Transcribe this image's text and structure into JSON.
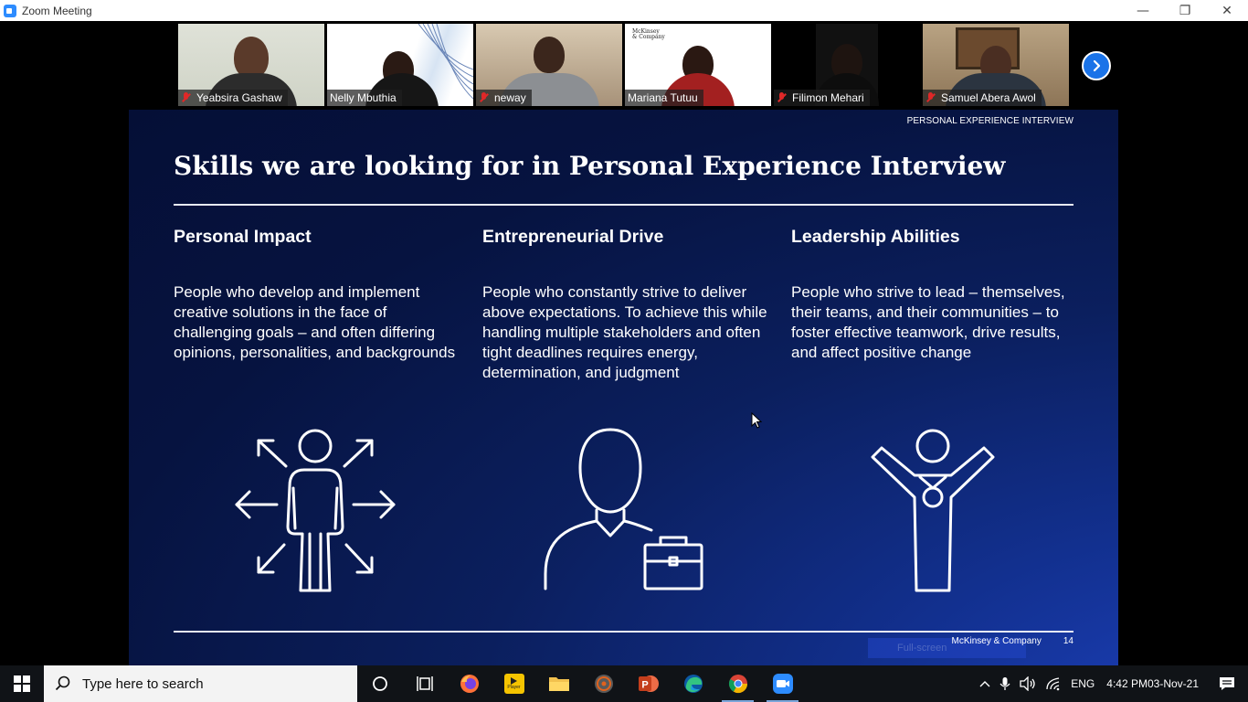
{
  "window": {
    "title": "Zoom Meeting",
    "minimize": "—",
    "restore": "❐",
    "close": "✕"
  },
  "gallery": {
    "participants": [
      {
        "name": "Yeabsira Gashaw",
        "muted": true
      },
      {
        "name": "Nelly Mbuthia",
        "muted": false
      },
      {
        "name": "neway",
        "muted": true
      },
      {
        "name": "Mariana Tutuu",
        "muted": false,
        "active_speaker": true,
        "logo_text_line1": "McKinsey",
        "logo_text_line2": "& Company"
      },
      {
        "name": "Filimon Mehari",
        "muted": true
      },
      {
        "name": "Samuel Abera Awol",
        "muted": true
      }
    ]
  },
  "slide": {
    "tag": "PERSONAL EXPERIENCE INTERVIEW",
    "title": "Skills we are looking for in Personal Experience Interview",
    "columns": [
      {
        "heading": "Personal Impact",
        "body": "People who develop and implement creative solutions in the face of challenging goals – and often differing opinions, personalities, and backgrounds",
        "icon": "person-arrows-icon"
      },
      {
        "heading": "Entrepreneurial Drive",
        "body": "People who constantly strive to deliver above expectations.  To achieve this while handling multiple stakeholders and often tight deadlines requires energy, determination, and judgment",
        "icon": "person-briefcase-icon"
      },
      {
        "heading": "Leadership Abilities",
        "body": "People who strive to lead – themselves, their teams, and their communities – to foster effective teamwork, drive results, and affect positive change",
        "icon": "person-medal-icon"
      }
    ],
    "footer_company": "McKinsey & Company",
    "page_number": "14",
    "fullscreen_hint": "Full-screen"
  },
  "taskbar": {
    "search_placeholder": "Type here to search",
    "apps": [
      "cortana-icon",
      "task-view-icon",
      "firefox-icon",
      "player-icon",
      "file-explorer-icon",
      "media-icon",
      "powerpoint-icon",
      "edge-icon",
      "chrome-icon",
      "zoom-icon"
    ],
    "player_label": "Player",
    "language": "ENG",
    "time": "4:42 PM",
    "date": "03-Nov-21"
  },
  "colors": {
    "slide_dark": "#050f36",
    "slide_accent": "#1c3fb8",
    "zoom_blue": "#2d8cff",
    "mute_red": "#e02828",
    "active_speaker_outline": "#f5f085"
  }
}
